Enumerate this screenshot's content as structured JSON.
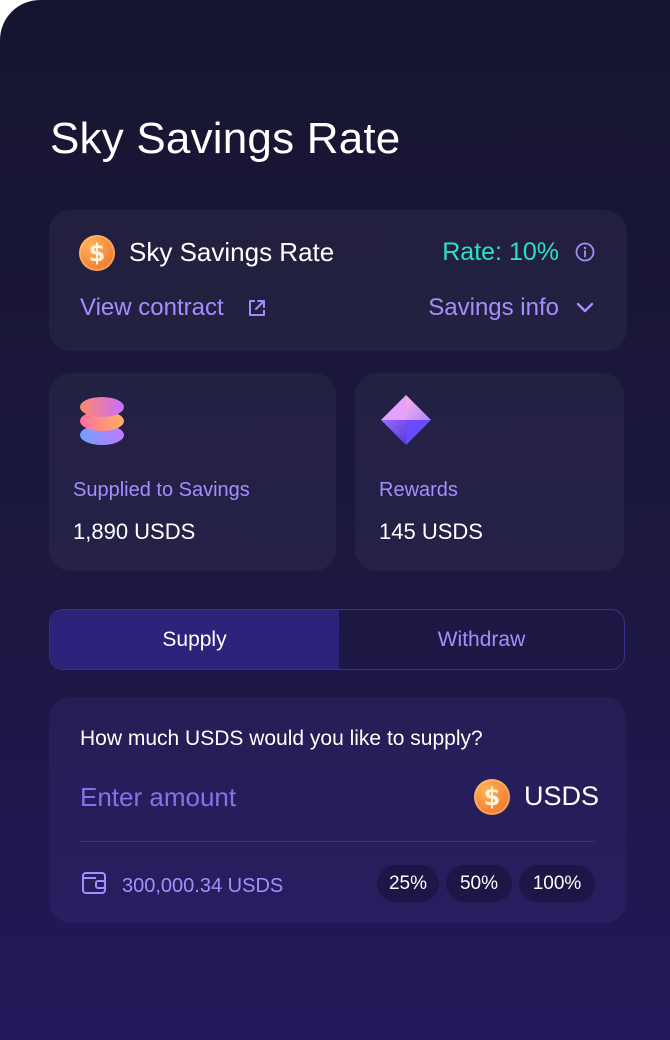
{
  "page": {
    "title": "Sky Savings Rate"
  },
  "rate_card": {
    "coin_icon": "usds-coin-icon",
    "title": "Sky Savings Rate",
    "rate_text": "Rate: 10%",
    "view_contract": "View contract",
    "savings_info": "Savings info"
  },
  "stats": {
    "supplied": {
      "icon": "stack-icon",
      "label": "Supplied to Savings",
      "value": "1,890 USDS"
    },
    "rewards": {
      "icon": "gem-icon",
      "label": "Rewards",
      "value": "145 USDS"
    }
  },
  "tabs": {
    "supply": "Supply",
    "withdraw": "Withdraw",
    "active": "Supply"
  },
  "input_card": {
    "question": "How much USDS would you like to supply?",
    "placeholder": "Enter amount",
    "token": "USDS",
    "balance": "300,000.34 USDS",
    "percent_options": [
      "25%",
      "50%",
      "100%"
    ]
  },
  "colors": {
    "accent": "#a68dff",
    "rate": "#2ee0c0",
    "active_tab": "#2e237a"
  }
}
